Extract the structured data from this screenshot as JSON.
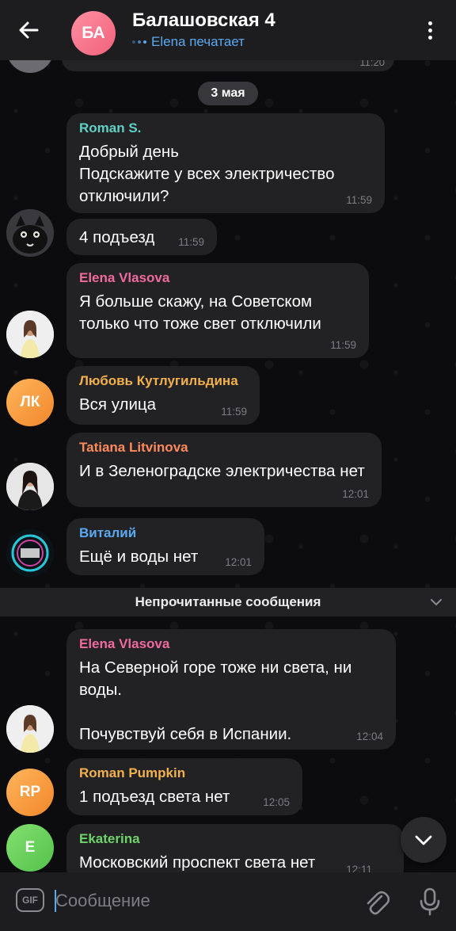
{
  "header": {
    "avatar_initials": "БА",
    "title": "Балашовская 4",
    "status": "Elena печатает"
  },
  "date_separator": "3 мая",
  "messages": [
    {
      "sender": "Roman S.",
      "sender_color": "#5fd1c6",
      "text": "Добрый день\nПодскажите у всех электричество отключили?",
      "time": "11:59"
    },
    {
      "sender": "",
      "text": "4 подъезд",
      "time": "11:59"
    },
    {
      "sender": "Elena Vlasova",
      "sender_color": "#f06a9e",
      "text": "Я больше скажу, на Советском только что тоже свет отключили",
      "time": "11:59"
    },
    {
      "sender": "Любовь Кутлугильдина",
      "sender_color": "#f2b14d",
      "text": "Вся улица",
      "time": "11:59",
      "avatar_initials": "ЛК"
    },
    {
      "sender": "Tatiana Litvinova",
      "sender_color": "#ff8a5c",
      "text": "И в Зеленоградске электричества нет",
      "time": "12:01"
    },
    {
      "sender": "Виталий",
      "sender_color": "#5aa9f0",
      "text": "Ещё и воды нет",
      "time": "12:01"
    },
    {
      "sender": "Elena Vlasova",
      "sender_color": "#f06a9e",
      "text": "На Северной горе тоже ни света, ни воды.\n\nПочувствуй себя в Испании.",
      "time": "12:04"
    },
    {
      "sender": "Roman Pumpkin",
      "sender_color": "#f2b14d",
      "text": "1 подъезд света нет",
      "time": "12:05",
      "avatar_initials": "RP"
    },
    {
      "sender": "Ekaterina",
      "sender_color": "#6ed46a",
      "text": "Московский проспект света нет",
      "time": "12:11",
      "avatar_initials": "E"
    }
  ],
  "unread_label": "Непрочитанные сообщения",
  "composer": {
    "gif_label": "GIF",
    "placeholder": "Сообщение"
  },
  "colors": {
    "accent": "#5aa9f0",
    "bubble": "#222224",
    "header": "#1d1d1f"
  }
}
